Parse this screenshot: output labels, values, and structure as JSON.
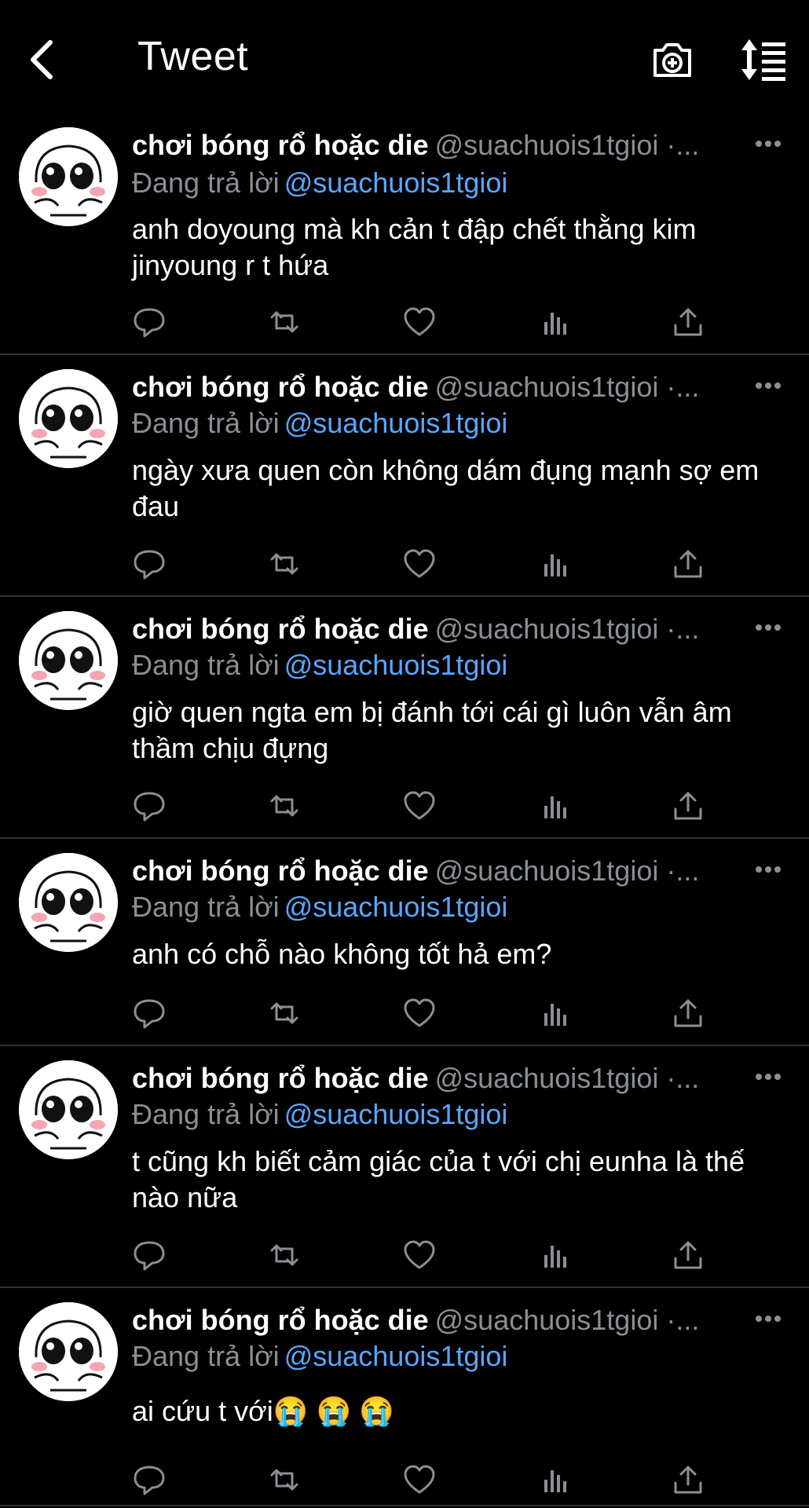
{
  "header": {
    "title": "Tweet",
    "back_icon": "chevron-left-icon",
    "camera_icon": "camera-plus-icon",
    "sort_icon": "sort-list-icon"
  },
  "colors": {
    "background": "#000000",
    "text": "#ffffff",
    "secondary": "#8b8f94",
    "link": "#5aa6ff",
    "divider": "#2f3336"
  },
  "tweets": [
    {
      "display_name": "chơi bóng rổ hoặc die",
      "handle": "@suachuois1tgioi ·...",
      "reply_prefix": "Đang trả lời",
      "reply_to": "@suachuois1tgioi",
      "text": "anh doyoung mà kh cản t đập chết thằng kim jinyoung r t hứa"
    },
    {
      "display_name": "chơi bóng rổ hoặc die",
      "handle": "@suachuois1tgioi ·...",
      "reply_prefix": "Đang trả lời",
      "reply_to": "@suachuois1tgioi",
      "text": "ngày xưa quen còn không dám đụng mạnh sợ em đau"
    },
    {
      "display_name": "chơi bóng rổ hoặc die",
      "handle": "@suachuois1tgioi ·...",
      "reply_prefix": "Đang trả lời",
      "reply_to": "@suachuois1tgioi",
      "text": "giờ quen ngta em bị đánh tới cái gì luôn vẫn âm thầm chịu đựng"
    },
    {
      "display_name": "chơi bóng rổ hoặc die",
      "handle": "@suachuois1tgioi ·...",
      "reply_prefix": "Đang trả lời",
      "reply_to": "@suachuois1tgioi",
      "text": "anh có chỗ nào không tốt hả em?"
    },
    {
      "display_name": "chơi bóng rổ hoặc die",
      "handle": "@suachuois1tgioi ·...",
      "reply_prefix": "Đang trả lời",
      "reply_to": "@suachuois1tgioi",
      "text": "t cũng kh biết cảm giác của t với chị eunha là thế nào nữa"
    },
    {
      "display_name": "chơi bóng rổ hoặc die",
      "handle": "@suachuois1tgioi ·...",
      "reply_prefix": "Đang trả lời",
      "reply_to": "@suachuois1tgioi",
      "text": "ai cứu t với😭 😭 😭"
    }
  ],
  "action_icons": [
    "reply-icon",
    "retweet-icon",
    "like-icon",
    "analytics-icon",
    "share-icon"
  ]
}
